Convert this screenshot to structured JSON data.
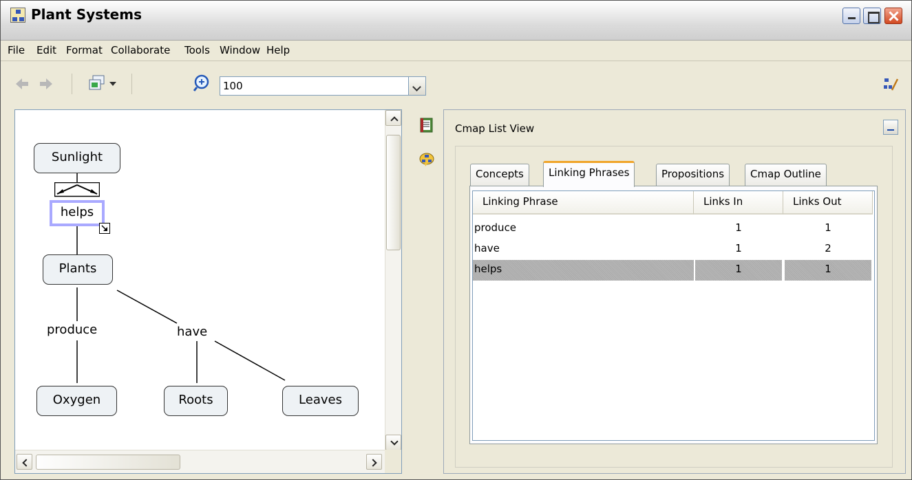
{
  "window": {
    "title": "Plant Systems"
  },
  "menu": [
    "File",
    "Edit",
    "Format",
    "Collaborate",
    "Tools",
    "Window",
    "Help"
  ],
  "toolbar": {
    "zoom_value": "100",
    "icons": [
      "back-arrow-icon",
      "forward-arrow-icon",
      "view-layout-icon",
      "zoom-in-icon",
      "collaboration-icon"
    ]
  },
  "map": {
    "concepts": [
      "Sunlight",
      "Plants",
      "Oxygen",
      "Roots",
      "Leaves"
    ],
    "phrases": [
      "helps",
      "produce",
      "have"
    ]
  },
  "list_view": {
    "title": "Cmap List View",
    "tabs": [
      "Concepts",
      "Linking Phrases",
      "Propositions",
      "Cmap Outline"
    ],
    "active_tab": "Linking Phrases",
    "columns": [
      "Linking Phrase",
      "Links In",
      "Links Out"
    ],
    "rows": [
      {
        "phrase": "produce",
        "in": "1",
        "out": "1",
        "selected": false
      },
      {
        "phrase": "have",
        "in": "1",
        "out": "2",
        "selected": false
      },
      {
        "phrase": "helps",
        "in": "1",
        "out": "1",
        "selected": true
      }
    ]
  },
  "colors": {
    "selection_outline": "#a9a9ff",
    "active_tab_accent": "#f0a428"
  }
}
